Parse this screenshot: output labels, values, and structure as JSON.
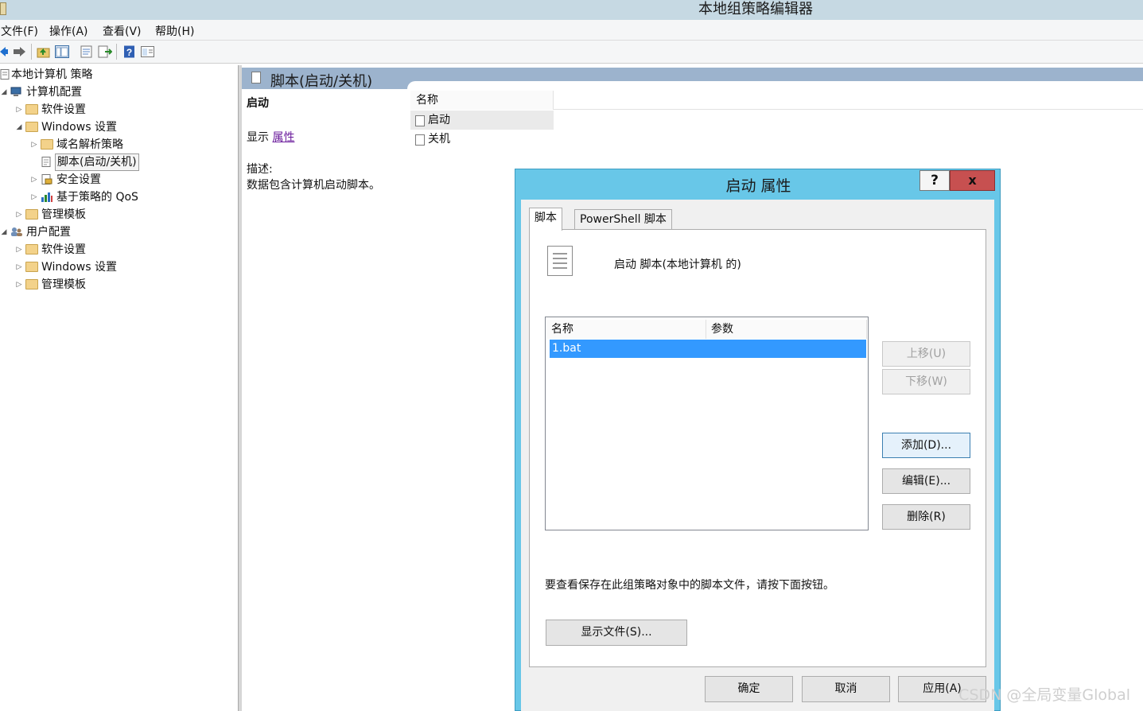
{
  "window": {
    "title": "本地组策略编辑器"
  },
  "menu": [
    "文件(F)",
    "操作(A)",
    "查看(V)",
    "帮助(H)"
  ],
  "toolbar_icons": [
    "back-arrow-icon",
    "forward-arrow-icon",
    "up-folder-icon",
    "show-hide-tree-icon",
    "properties-icon",
    "export-list-icon",
    "help-icon",
    "extended-view-icon"
  ],
  "tree": [
    {
      "label": "本地计算机 策略",
      "icon": "policy-icon"
    },
    {
      "label": "计算机配置",
      "icon": "computer-icon",
      "expanded": true
    },
    {
      "label": "软件设置",
      "icon": "folder-icon"
    },
    {
      "label": "Windows 设置",
      "icon": "folder-icon",
      "expanded": true
    },
    {
      "label": "域名解析策略",
      "icon": "folder-icon"
    },
    {
      "label": "脚本(启动/关机)",
      "icon": "script-icon",
      "selected": true
    },
    {
      "label": "安全设置",
      "icon": "security-icon"
    },
    {
      "label": "基于策略的 QoS",
      "icon": "chart-icon"
    },
    {
      "label": "管理模板",
      "icon": "folder-icon"
    },
    {
      "label": "用户配置",
      "icon": "users-icon",
      "expanded": true
    },
    {
      "label": "软件设置",
      "icon": "folder-icon"
    },
    {
      "label": "Windows 设置",
      "icon": "folder-icon"
    },
    {
      "label": "管理模板",
      "icon": "folder-icon"
    }
  ],
  "right_pane": {
    "header": "脚本(启动/关机)",
    "selected_item": "启动",
    "show_prefix": "显示",
    "properties_link": "属性",
    "description_label": "描述:",
    "description_text": "数据包含计算机启动脚本。",
    "list_column": "名称",
    "list_items": [
      "启动",
      "关机"
    ]
  },
  "dialog": {
    "title": "启动 属性",
    "help": "?",
    "close": "x",
    "tabs": [
      "脚本",
      "PowerShell 脚本"
    ],
    "heading": "启动 脚本(本地计算机 的)",
    "columns": [
      "名称",
      "参数"
    ],
    "rows": [
      {
        "name": "1.bat",
        "params": ""
      }
    ],
    "buttons": {
      "up": "上移(U)",
      "down": "下移(W)",
      "add": "添加(D)...",
      "edit": "编辑(E)...",
      "delete": "删除(R)",
      "show_files": "显示文件(S)...",
      "ok": "确定",
      "cancel": "取消",
      "apply": "应用(A)"
    },
    "hint": "要查看保存在此组策略对象中的脚本文件，请按下面按钮。"
  },
  "watermark": "CSDN @全局变量Global"
}
